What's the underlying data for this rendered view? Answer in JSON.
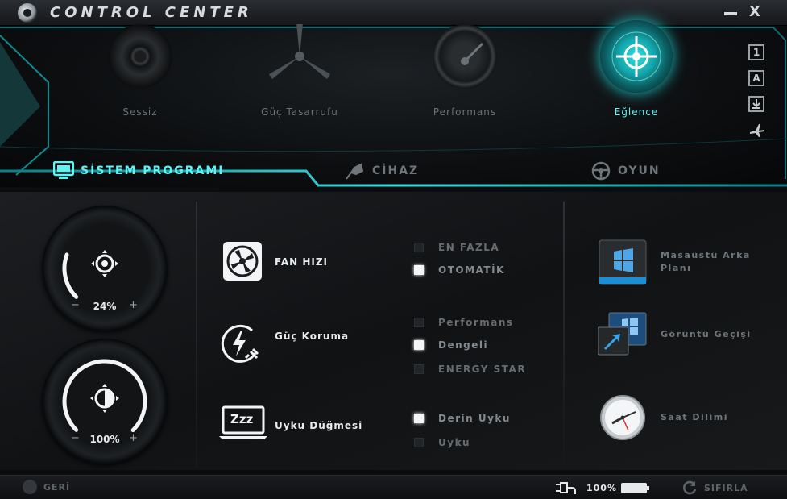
{
  "window": {
    "title": "CONTROL CENTER",
    "minimize_icon": "minimize-icon",
    "close_label": "X"
  },
  "modes": [
    {
      "label": "Sessiz",
      "icon": "speaker-icon",
      "active": false
    },
    {
      "label": "Güç Tasarrufu",
      "icon": "fan-blades-icon",
      "active": false
    },
    {
      "label": "Performans",
      "icon": "speedometer-icon",
      "active": false
    },
    {
      "label": "Eğlence",
      "icon": "crosshair-radar-icon",
      "active": true
    }
  ],
  "side_icons": [
    {
      "label": "1",
      "icon": "display-1-icon"
    },
    {
      "label": "A",
      "icon": "letter-a-icon"
    },
    {
      "label": "",
      "icon": "download-icon"
    },
    {
      "label": "",
      "icon": "airplane-icon"
    }
  ],
  "tabs": [
    {
      "label": "SİSTEM PROGRAMI",
      "icon": "monitor-icon",
      "active": true
    },
    {
      "label": "CİHAZ",
      "icon": "usb-plug-icon",
      "active": false
    },
    {
      "label": "OYUN",
      "icon": "steering-wheel-icon",
      "active": false
    }
  ],
  "dials": [
    {
      "name": "brightness",
      "icon": "brightness-icon",
      "value": "24%",
      "level": 0.24,
      "minus": "−",
      "plus": "+"
    },
    {
      "name": "contrast",
      "icon": "contrast-icon",
      "value": "100%",
      "level": 1.0,
      "minus": "−",
      "plus": "+"
    }
  ],
  "features": {
    "fan": {
      "title": "FAN HIZI",
      "icon": "fan-icon",
      "options": [
        {
          "label": "EN FAZLA",
          "checked": false
        },
        {
          "label": "OTOMATİK",
          "checked": true
        }
      ]
    },
    "power": {
      "title": "Güç Koruma",
      "icon": "power-plug-icon",
      "options": [
        {
          "label": "Performans",
          "checked": false
        },
        {
          "label": "Dengeli",
          "checked": true
        },
        {
          "label": "ENERGY STAR",
          "checked": false
        }
      ]
    },
    "sleep": {
      "title": "Uyku Düğmesi",
      "icon": "sleep-laptop-icon",
      "icon_text": "Zzz",
      "options": [
        {
          "label": "Derin Uyku",
          "checked": true
        },
        {
          "label": "Uyku",
          "checked": false
        }
      ]
    }
  },
  "right_items": [
    {
      "label": "Masaüstü Arka Planı",
      "icon": "windows-wallpaper-icon"
    },
    {
      "label": "Görüntü Geçişi",
      "icon": "display-switch-icon"
    },
    {
      "label": "Saat Dilimi",
      "icon": "clock-icon"
    }
  ],
  "bottom": {
    "back_label": "GERİ",
    "back_icon": "back-icon",
    "power_icon": "ac-power-icon",
    "battery_value": "100%",
    "battery_level": 1.0,
    "battery_icon": "battery-icon",
    "reset_label": "SIFIRLA",
    "reset_icon": "reset-icon"
  },
  "colors": {
    "accent": "#5ff3f3",
    "accent_dark": "#0a6c70"
  }
}
